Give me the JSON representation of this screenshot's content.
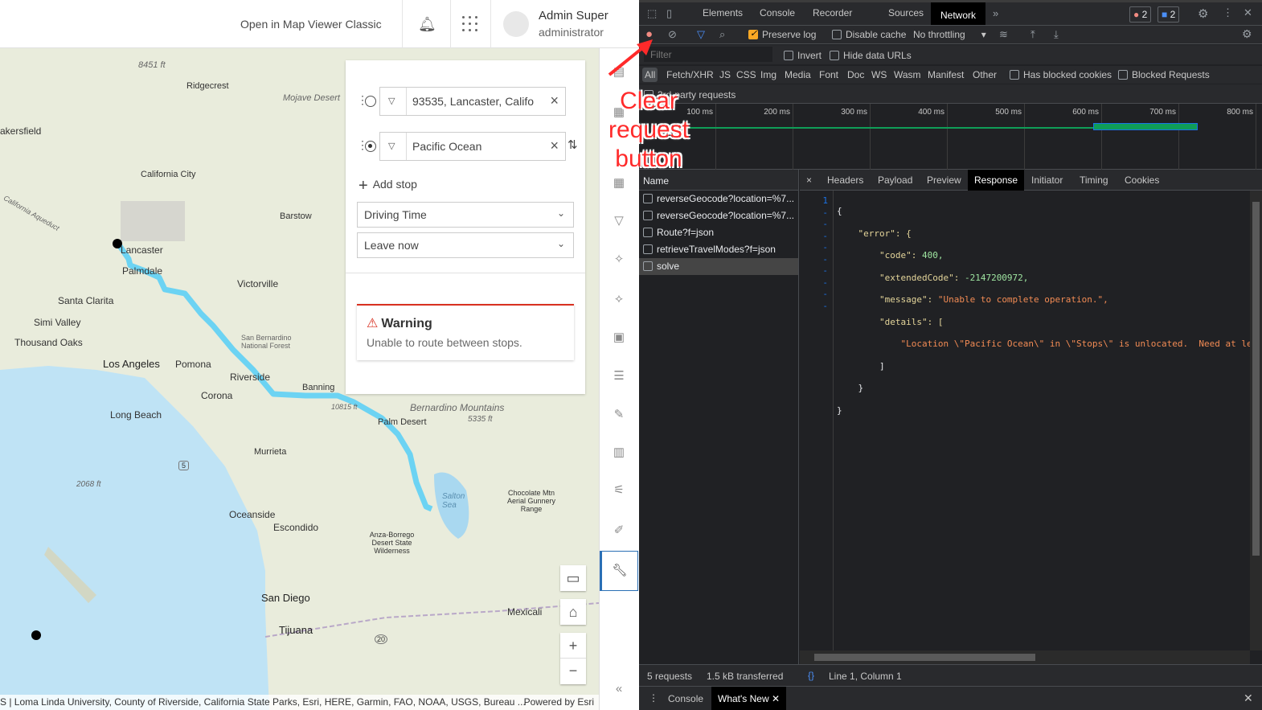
{
  "header": {
    "open_classic": "Open in Map Viewer Classic",
    "user_name": "Admin Super",
    "user_role": "administrator"
  },
  "map_labels": [
    "Mojave Desert",
    "Ridgecrest",
    "8451 ft",
    "akersfield",
    "California City",
    "Barstow",
    "Lancaster",
    "Palmdale",
    "Victorville",
    "Santa Clarita",
    "Simi Valley",
    "Thousand Oaks",
    "Los Angeles",
    "Pomona",
    "San Bernardino National Forest",
    "Riverside",
    "Banning",
    "Corona",
    "Long Beach",
    "Bernardino Mountains",
    "10815 ft",
    "Palm Desert",
    "5335 ft",
    "Murrieta",
    "2068 ft",
    "Salton Sea",
    "Chocolate Mtn Aerial Gunnery Range",
    "Oceanside",
    "Escondido",
    "Anza-Borrego Desert State Wilderness",
    "San Diego",
    "Tijuana",
    "Mexicali",
    "California Aqueduct",
    "5",
    "20"
  ],
  "directions": {
    "stops": [
      {
        "value": "93535, Lancaster, Califo"
      },
      {
        "value": "Pacific Ocean"
      }
    ],
    "add_stop": "Add stop",
    "travel_mode": "Driving Time",
    "departure": "Leave now",
    "warning_title": "Warning",
    "warning_message": "Unable to route between stops."
  },
  "attribution": {
    "text": "S | Loma Linda University, County of Riverside, California State Parks, Esri, HERE, Garmin, FAO, NOAA, USGS, Bureau ...",
    "powered": "Powered by Esri"
  },
  "annotation": {
    "text": "Clear request button",
    "color": "#ff2a2a"
  },
  "devtools": {
    "tabs": [
      "Elements",
      "Console",
      "Recorder",
      "Sources",
      "Network"
    ],
    "active_tab": "Network",
    "errors": "2",
    "messages": "2",
    "preserve_log": "Preserve log",
    "disable_cache": "Disable cache",
    "throttling": "No throttling",
    "filter_placeholder": "Filter",
    "invert": "Invert",
    "hide_data_urls": "Hide data URLs",
    "types": [
      "All",
      "Fetch/XHR",
      "JS",
      "CSS",
      "Img",
      "Media",
      "Font",
      "Doc",
      "WS",
      "Wasm",
      "Manifest",
      "Other"
    ],
    "has_blocked_cookies": "Has blocked cookies",
    "blocked_requests": "Blocked Requests",
    "third_party": "3rd-party requests",
    "ticks": [
      "100 ms",
      "200 ms",
      "300 ms",
      "400 ms",
      "500 ms",
      "600 ms",
      "700 ms",
      "800 ms"
    ],
    "name_header": "Name",
    "requests": [
      "reverseGeocode?location=%7...",
      "reverseGeocode?location=%7...",
      "Route?f=json",
      "retrieveTravelModes?f=json",
      "solve"
    ],
    "detail_tabs": [
      "Headers",
      "Payload",
      "Preview",
      "Response",
      "Initiator",
      "Timing",
      "Cookies"
    ],
    "active_detail": "Response",
    "response": {
      "open": "{",
      "error_key": "\"error\": {",
      "code_key": "\"code\": ",
      "code_val": "400,",
      "ext_key": "\"extendedCode\": ",
      "ext_val": "-2147200972,",
      "msg_key": "\"message\": ",
      "msg_val": "\"Unable to complete operation.\",",
      "details_key": "\"details\": [",
      "detail_line": "\"Location \\\"Pacific Ocean\\\" in \\\"Stops\\\" is unlocated.  Need at le",
      "close_arr": "]",
      "close_obj": "}",
      "close": "}"
    },
    "status_requests": "5 requests",
    "status_transferred": "1.5 kB transferred",
    "cursor": "Line 1, Column 1",
    "drawer_tabs": [
      "Console",
      "What's New"
    ]
  }
}
